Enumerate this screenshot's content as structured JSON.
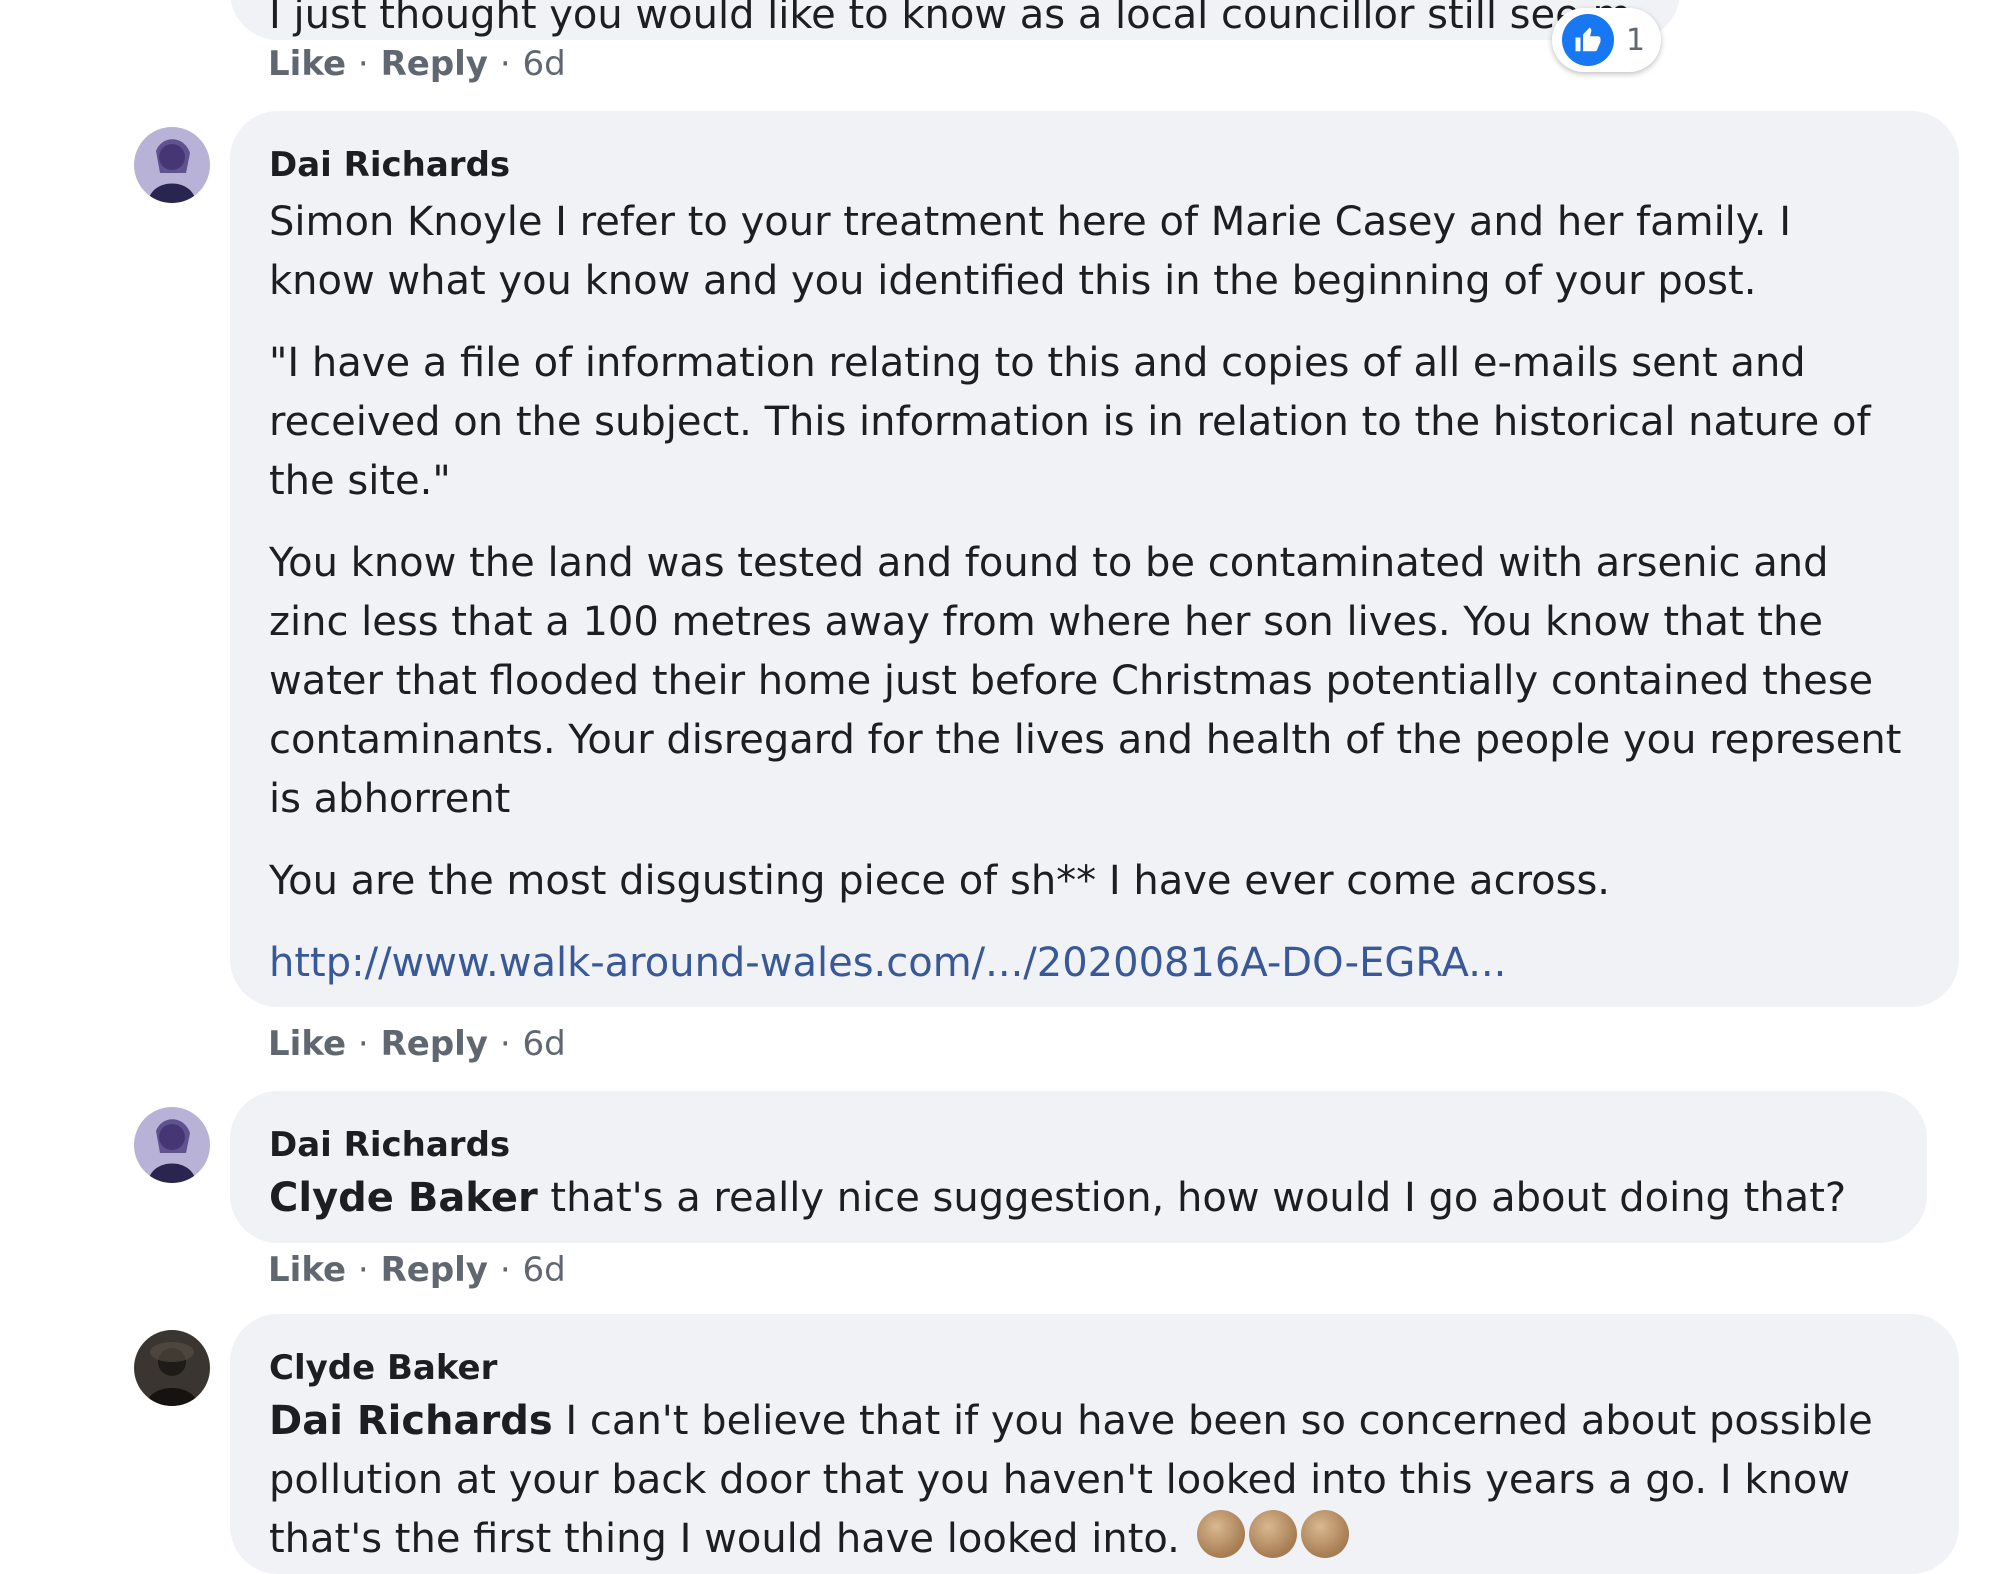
{
  "top_comment": {
    "text_fragment": "I just thought you would like to know as a local councillor still see more",
    "reaction_count": "1"
  },
  "action_labels": {
    "like": "Like",
    "reply": "Reply",
    "separator": "·"
  },
  "comments": [
    {
      "author": "Dai Richards",
      "mention": "",
      "paragraphs": [
        "Simon Knoyle I refer to your treatment here of Marie Casey and her family. I know what you know and you identified this in the beginning of your post.",
        "\"I have a file of information relating to this and copies of all e-mails sent and received on the subject. This information is in relation to the historical nature of the site.\"",
        "You know the land was tested and found to be contaminated with arsenic and zinc less that a 100 metres away from where her son lives. You know that the water that flooded their home just before Christmas potentially contained these contaminants. Your disregard for the lives and health of the people you represent is abhorrent",
        "You are the most disgusting piece of sh** I have ever come across."
      ],
      "link": "http://www.walk-around-wales.com/.../20200816A-DO-EGRA...",
      "time": "6d"
    },
    {
      "author": "Dai Richards",
      "mention": "Clyde Baker",
      "text": "that's a really nice suggestion, how would I go about doing that?",
      "time": "6d"
    },
    {
      "author": "Clyde Baker",
      "mention": "Dai Richards",
      "text": "I can't believe that if you have been so concerned about possible pollution at your back door that you haven't looked into this years a go. I know that's the first thing I would have looked into.",
      "emoji_count": 3
    }
  ],
  "top_time": "6d",
  "colors": {
    "bubble": "#f0f2f5",
    "link": "#385898",
    "meta": "#606770",
    "like_blue": "#1877f2"
  }
}
